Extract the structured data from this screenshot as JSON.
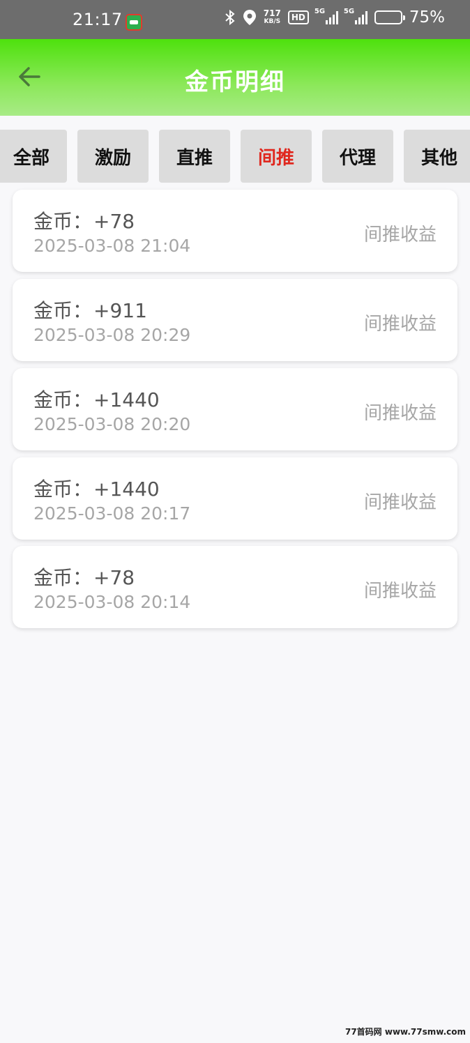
{
  "status_bar": {
    "time": "21:17",
    "net_speed_value": "717",
    "net_speed_unit": "KB/S",
    "hd_label": "HD",
    "signal1_label": "5G",
    "signal2_label": "5G",
    "battery_percent": "75%",
    "icons": [
      "bluetooth-icon",
      "location-icon",
      "battery-icon"
    ]
  },
  "header": {
    "title": "金币明细",
    "back_icon": "arrow-left-icon"
  },
  "tabs": [
    {
      "label": "全部",
      "active": false
    },
    {
      "label": "激励",
      "active": false
    },
    {
      "label": "直推",
      "active": false
    },
    {
      "label": "间推",
      "active": true
    },
    {
      "label": "代理",
      "active": false
    },
    {
      "label": "其他",
      "active": false
    }
  ],
  "records": [
    {
      "label": "金币：",
      "amount": "+78",
      "time": "2025-03-08 21:04",
      "type": "间推收益"
    },
    {
      "label": "金币：",
      "amount": "+911",
      "time": "2025-03-08 20:29",
      "type": "间推收益"
    },
    {
      "label": "金币：",
      "amount": "+1440",
      "time": "2025-03-08 20:20",
      "type": "间推收益"
    },
    {
      "label": "金币：",
      "amount": "+1440",
      "time": "2025-03-08 20:17",
      "type": "间推收益"
    },
    {
      "label": "金币：",
      "amount": "+78",
      "time": "2025-03-08 20:14",
      "type": "间推收益"
    }
  ],
  "watermark": "77首码网 www.77smw.com",
  "colors": {
    "header_green": "#4ee10d",
    "active_tab": "#e0281f",
    "tab_bg": "#dcdcdc"
  }
}
